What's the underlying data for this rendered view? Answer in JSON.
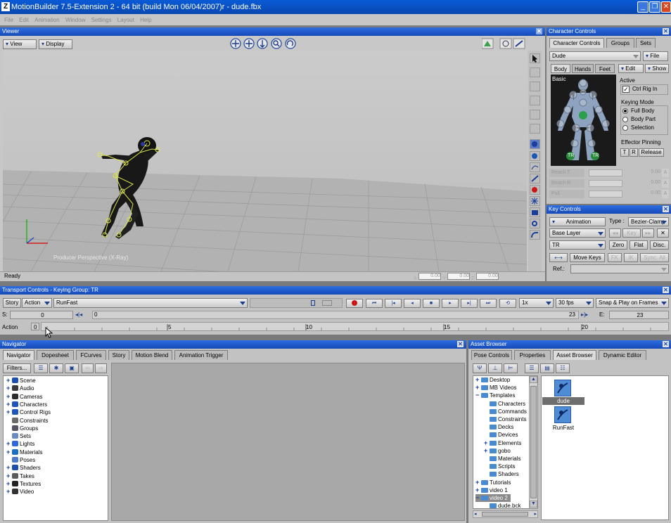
{
  "window": {
    "title": "MotionBuilder 7.5-Extension 2 - 64 bit (build Mon 06/04/2007)r - dude.fbx",
    "min": "_",
    "restore": "❐",
    "close": "✕",
    "app_icon": "Z"
  },
  "menu": [
    "File",
    "Edit",
    "Animation",
    "Window",
    "Settings",
    "Layout",
    "Help"
  ],
  "viewer": {
    "title": "Viewer",
    "view": "View",
    "display": "Display",
    "camera_label": "Producer Perspective (X-Ray)",
    "status": "Ready",
    "coords": [
      "0.00",
      "0.00",
      "0.00"
    ],
    "coord_labels": [
      "X",
      "Y",
      "Z"
    ]
  },
  "character_controls": {
    "title": "Character Controls",
    "tabs": [
      "Character Controls",
      "Groups",
      "Sets"
    ],
    "character": "Dude",
    "file": "File",
    "body_tabs": [
      "Body",
      "Hands",
      "Feet"
    ],
    "edit": "Edit",
    "show": "Show",
    "basic": "Basic",
    "active_label": "Active",
    "ctrl_rig": "Ctrl Rig In",
    "keying_mode": "Keying Mode",
    "modes": [
      "Full Body",
      "Body Part",
      "Selection"
    ],
    "effector_pinning": "Effector Pinning",
    "pin_t": "T",
    "pin_r": "R",
    "release": "Release",
    "tr": "TR",
    "sliders": [
      {
        "label": "Reach T",
        "value": "0.00"
      },
      {
        "label": "Reach R",
        "value": "0.00"
      },
      {
        "label": "Pull",
        "value": "0.00"
      }
    ],
    "slider_a": "A"
  },
  "key_controls": {
    "title": "Key Controls",
    "animation": "Animation",
    "type_label": "Type :",
    "type": "Bezier-Clamp",
    "layer": "Base Layer",
    "key": "Key",
    "tr": "TR",
    "zero": "Zero",
    "flat": "Flat",
    "disc": "Disc.",
    "move_keys": "Move Keys",
    "fk": "FK",
    "ik": "IK",
    "sync": "Sync. All",
    "ref": "Ref.:"
  },
  "transport": {
    "title": "Transport Controls - Keying Group: TR",
    "story": "Story",
    "action": "Action",
    "take": "RunFast",
    "speed": "1x",
    "fps": "30 fps",
    "snap": "Snap & Play on Frames",
    "s_label": "S:",
    "s_value": "0",
    "cur_value": "0",
    "e_label": "E:",
    "e_value": "23",
    "end_field": "23",
    "action_label": "Action",
    "frame": "0",
    "ticks": [
      "5",
      "10",
      "15",
      "20"
    ]
  },
  "navigator": {
    "title": "Navigator",
    "tabs": [
      "Navigator",
      "Dopesheet",
      "FCurves",
      "Story",
      "Motion Blend",
      "Animation Trigger"
    ],
    "filters": "Filters...",
    "tree": [
      {
        "label": "Scene",
        "plus": "+",
        "color": "#1b4fb0"
      },
      {
        "label": "Audio",
        "plus": "+",
        "color": "#3a3a3a"
      },
      {
        "label": "Cameras",
        "plus": "+",
        "color": "#2c2c2c"
      },
      {
        "label": "Characters",
        "plus": "+",
        "color": "#1f55b8"
      },
      {
        "label": "Control Rigs",
        "plus": "+",
        "color": "#1f55b8"
      },
      {
        "label": "Constraints",
        "plus": "",
        "color": "#6a6a6a"
      },
      {
        "label": "Groups",
        "plus": "",
        "color": "#556"
      },
      {
        "label": "Sets",
        "plus": "",
        "color": "#6a8ac0"
      },
      {
        "label": "Lights",
        "plus": "+",
        "color": "#2d6ad8"
      },
      {
        "label": "Materials",
        "plus": "+",
        "color": "#1b6ec0"
      },
      {
        "label": "Poses",
        "plus": "",
        "color": "#4a7ac8"
      },
      {
        "label": "Shaders",
        "plus": "+",
        "color": "#1c4fa8"
      },
      {
        "label": "Takes",
        "plus": "+",
        "color": "#5b5b5b"
      },
      {
        "label": "Textures",
        "plus": "+",
        "color": "#222"
      },
      {
        "label": "Video",
        "plus": "+",
        "color": "#333"
      }
    ]
  },
  "asset_browser": {
    "title": "Asset Browser",
    "tabs": [
      "Pose Controls",
      "Properties",
      "Asset Browser",
      "Dynamic Editor"
    ],
    "tree": [
      {
        "label": "Desktop",
        "plus": "+",
        "indent": 0
      },
      {
        "label": "MB Videos",
        "plus": "+",
        "indent": 0
      },
      {
        "label": "Templates",
        "plus": "−",
        "indent": 0
      },
      {
        "label": "Characters",
        "plus": "",
        "indent": 1
      },
      {
        "label": "Commands",
        "plus": "",
        "indent": 1
      },
      {
        "label": "Constraints",
        "plus": "",
        "indent": 1
      },
      {
        "label": "Decks",
        "plus": "",
        "indent": 1
      },
      {
        "label": "Devices",
        "plus": "",
        "indent": 1
      },
      {
        "label": "Elements",
        "plus": "+",
        "indent": 1
      },
      {
        "label": "gobo",
        "plus": "+",
        "indent": 1
      },
      {
        "label": "Materials",
        "plus": "",
        "indent": 1
      },
      {
        "label": "Scripts",
        "plus": "",
        "indent": 1
      },
      {
        "label": "Shaders",
        "plus": "",
        "indent": 1
      },
      {
        "label": "Tutorials",
        "plus": "+",
        "indent": 0
      },
      {
        "label": "video 1",
        "plus": "+",
        "indent": 0
      },
      {
        "label": "video 2",
        "plus": "−",
        "indent": 0
      },
      {
        "label": "dude.bck",
        "plus": "",
        "indent": 1
      }
    ],
    "files": [
      "dude",
      "RunFast"
    ]
  }
}
